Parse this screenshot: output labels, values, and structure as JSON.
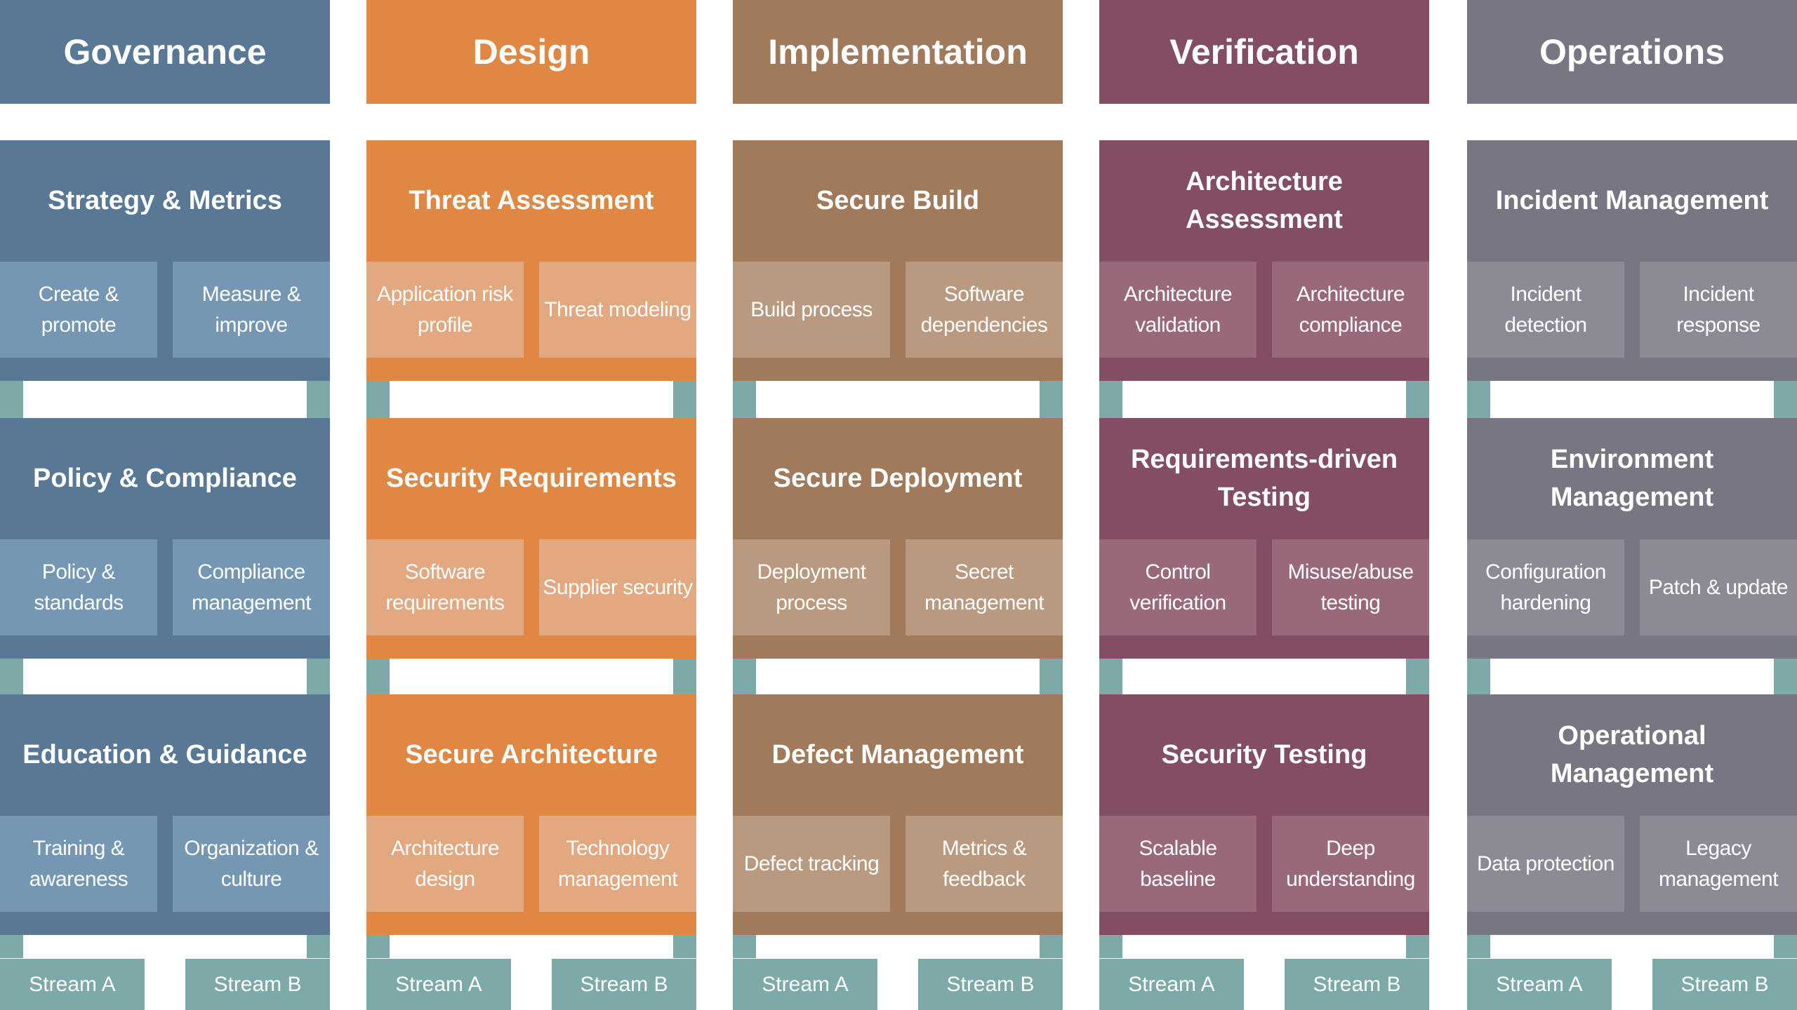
{
  "colors": {
    "stream": "#7da9a8"
  },
  "functions": [
    {
      "name": "Governance",
      "color": "#587895",
      "activity_color": "#7597b3",
      "practices": [
        {
          "name": "Strategy & Metrics",
          "activities": [
            "Create & promote",
            "Measure & improve"
          ]
        },
        {
          "name": "Policy & Compliance",
          "activities": [
            "Policy & standards",
            "Compliance management"
          ]
        },
        {
          "name": "Education & Guidance",
          "activities": [
            "Training & awareness",
            "Organization & culture"
          ]
        }
      ],
      "streams": [
        "Stream A",
        "Stream B"
      ]
    },
    {
      "name": "Design",
      "color": "#e08743",
      "activity_color": "#e3a880",
      "practices": [
        {
          "name": "Threat Assessment",
          "activities": [
            "Application risk profile",
            "Threat modeling"
          ]
        },
        {
          "name": "Security Requirements",
          "activities": [
            "Software requirements",
            "Supplier security"
          ]
        },
        {
          "name": "Secure Architecture",
          "activities": [
            "Architecture design",
            "Technology management"
          ]
        }
      ],
      "streams": [
        "Stream A",
        "Stream B"
      ]
    },
    {
      "name": "Implementation",
      "color": "#a07a5b",
      "activity_color": "#b99a80",
      "practices": [
        {
          "name": "Secure Build",
          "activities": [
            "Build process",
            "Software dependencies"
          ]
        },
        {
          "name": "Secure Deployment",
          "activities": [
            "Deployment process",
            "Secret management"
          ]
        },
        {
          "name": "Defect Management",
          "activities": [
            "Defect tracking",
            "Metrics & feedback"
          ]
        }
      ],
      "streams": [
        "Stream A",
        "Stream B"
      ]
    },
    {
      "name": "Verification",
      "color": "#834e63",
      "activity_color": "#9a687b",
      "practices": [
        {
          "name": "Architecture Assessment",
          "activities": [
            "Architecture validation",
            "Architecture compliance"
          ]
        },
        {
          "name": "Requirements-driven Testing",
          "activities": [
            "Control verification",
            "Misuse/abuse testing"
          ]
        },
        {
          "name": "Security Testing",
          "activities": [
            "Scalable baseline",
            "Deep understanding"
          ]
        }
      ],
      "streams": [
        "Stream A",
        "Stream B"
      ]
    },
    {
      "name": "Operations",
      "color": "#777783",
      "activity_color": "#8b8b96",
      "practices": [
        {
          "name": "Incident Management",
          "activities": [
            "Incident detection",
            "Incident response"
          ]
        },
        {
          "name": "Environment Management",
          "activities": [
            "Configuration hardening",
            "Patch & update"
          ]
        },
        {
          "name": "Operational Management",
          "activities": [
            "Data protection",
            "Legacy management"
          ]
        }
      ],
      "streams": [
        "Stream A",
        "Stream B"
      ]
    }
  ]
}
